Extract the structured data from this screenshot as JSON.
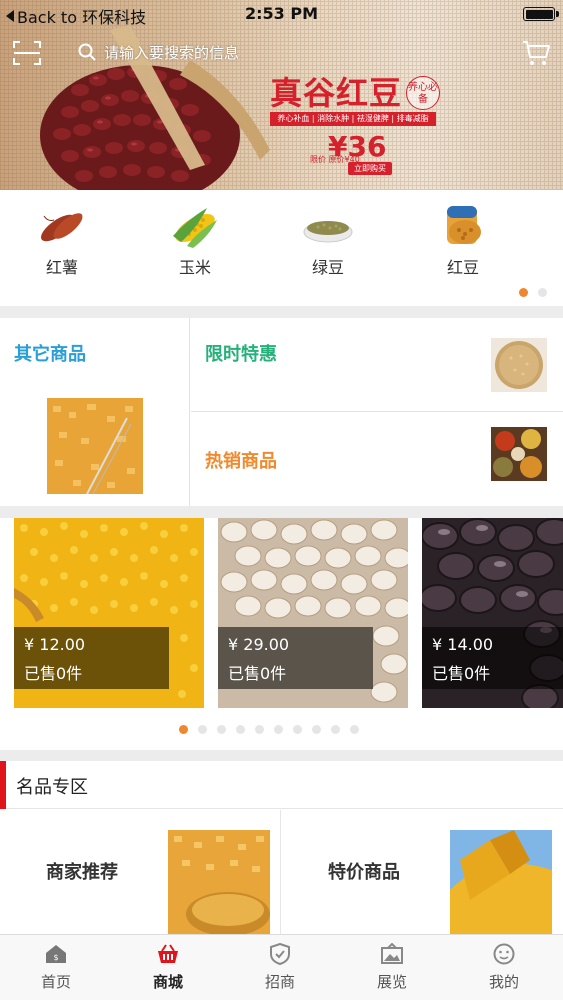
{
  "status_bar": {
    "back_label": "Back to 环保科技",
    "time": "2:53 PM"
  },
  "header": {
    "search_placeholder": "请输入要搜索的信息"
  },
  "banner": {
    "title": "真谷红豆",
    "seal_text": "养心必备",
    "tags": "养心补血 | 消除水肿 | 祛湿健脾 | 排毒减脂",
    "price": "¥36",
    "small_text": "限价 原价¥40",
    "button": "立即购买"
  },
  "categories": [
    {
      "label": "红薯",
      "icon": "sweet-potato-icon"
    },
    {
      "label": "玉米",
      "icon": "corn-icon"
    },
    {
      "label": "绿豆",
      "icon": "mung-bean-icon"
    },
    {
      "label": "红豆",
      "icon": "red-bean-icon"
    }
  ],
  "feature": {
    "left_title": "其它商品",
    "top_title": "限时特惠",
    "bottom_title": "热销商品",
    "colors": {
      "left": "#2a9fd6",
      "top": "#26b07a",
      "bottom": "#f08a2e"
    }
  },
  "products": [
    {
      "price": "¥ 12.00",
      "sold": "已售0件",
      "image": "millet"
    },
    {
      "price": "¥ 29.00",
      "sold": "已售0件",
      "image": "job-tears"
    },
    {
      "price": "¥ 14.00",
      "sold": "已售0件",
      "image": "black-beans"
    }
  ],
  "brand_zone": {
    "title": "名品专区",
    "cards": [
      {
        "label": "商家推荐"
      },
      {
        "label": "特价商品"
      }
    ]
  },
  "tabs": [
    {
      "label": "首页",
      "icon": "home-icon",
      "active": false
    },
    {
      "label": "商城",
      "icon": "mall-basket-icon",
      "active": true
    },
    {
      "label": "招商",
      "icon": "shield-icon",
      "active": false
    },
    {
      "label": "展览",
      "icon": "exhibition-icon",
      "active": false
    },
    {
      "label": "我的",
      "icon": "profile-face-icon",
      "active": false
    }
  ],
  "colors": {
    "accent": "#f0862e",
    "brand_red": "#e0141b",
    "promo_red": "#d4212c"
  }
}
